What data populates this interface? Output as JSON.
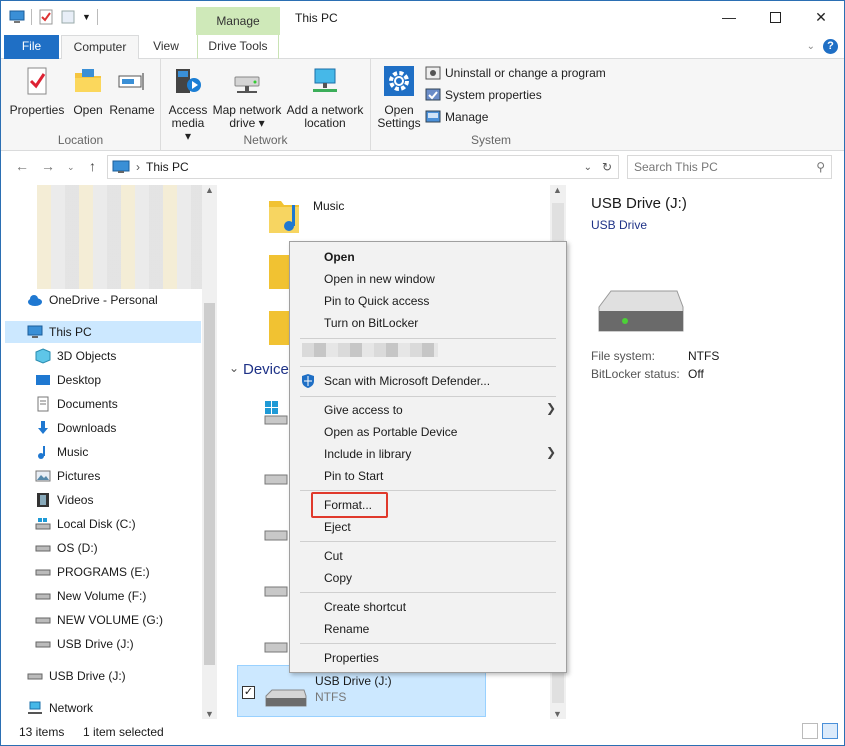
{
  "window": {
    "title": "This PC",
    "contextual_tab_header": "Manage"
  },
  "tabs": {
    "file": "File",
    "computer": "Computer",
    "view": "View",
    "drive_tools": "Drive Tools"
  },
  "ribbon": {
    "location": {
      "label": "Location",
      "properties": "Properties",
      "open": "Open",
      "rename": "Rename"
    },
    "network": {
      "label": "Network",
      "access_media_1": "Access",
      "access_media_2": "media",
      "map_drive_1": "Map network",
      "map_drive_2": "drive",
      "add_location_1": "Add a network",
      "add_location_2": "location"
    },
    "system": {
      "label": "System",
      "open_settings_1": "Open",
      "open_settings_2": "Settings",
      "uninstall": "Uninstall or change a program",
      "system_properties": "System properties",
      "manage": "Manage"
    }
  },
  "address": {
    "path": "This PC",
    "search_placeholder": "Search This PC"
  },
  "nav": {
    "onedrive": "OneDrive - Personal",
    "this_pc": "This PC",
    "items": [
      "3D Objects",
      "Desktop",
      "Documents",
      "Downloads",
      "Music",
      "Pictures",
      "Videos",
      "Local Disk (C:)",
      "OS (D:)",
      "PROGRAMS (E:)",
      "New Volume (F:)",
      "NEW VOLUME (G:)",
      "USB Drive (J:)"
    ],
    "usb_root": "USB Drive (J:)",
    "network": "Network"
  },
  "content": {
    "music_folder": "Music",
    "devices_group": "Device",
    "selected_item": {
      "name": "USB Drive (J:)",
      "fs": "NTFS"
    }
  },
  "details": {
    "title": "USB Drive (J:)",
    "subtitle": "USB Drive",
    "fs_label": "File system:",
    "fs_value": "NTFS",
    "bitlocker_label": "BitLocker status:",
    "bitlocker_value": "Off"
  },
  "context_menu": {
    "open": "Open",
    "open_new_window": "Open in new window",
    "pin_quick_access": "Pin to Quick access",
    "bitlocker": "Turn on BitLocker",
    "defender": "Scan with Microsoft Defender...",
    "give_access": "Give access to",
    "portable_device": "Open as Portable Device",
    "include_library": "Include in library",
    "pin_start": "Pin to Start",
    "format": "Format...",
    "eject": "Eject",
    "cut": "Cut",
    "copy": "Copy",
    "create_shortcut": "Create shortcut",
    "rename": "Rename",
    "properties": "Properties"
  },
  "status": {
    "count": "13 items",
    "selected": "1 item selected"
  },
  "colors": {
    "accent": "#1f6fc5",
    "selection": "#cce8ff",
    "manage_tab": "#cfe9b9",
    "highlight": "#e0392b"
  }
}
